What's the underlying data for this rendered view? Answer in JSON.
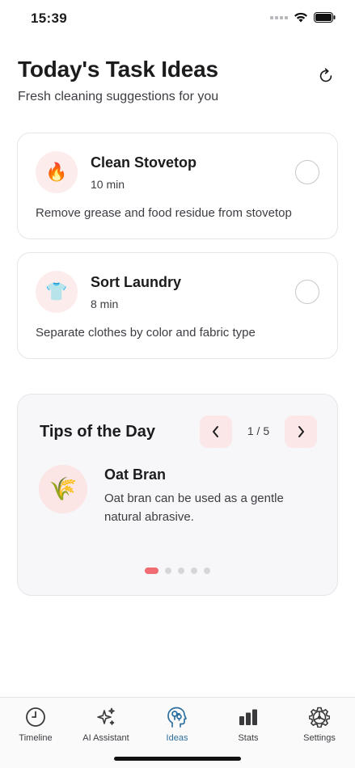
{
  "status_bar": {
    "time": "15:39"
  },
  "header": {
    "title": "Today's Task Ideas",
    "subtitle": "Fresh cleaning suggestions for you"
  },
  "tasks": [
    {
      "icon": "🔥",
      "icon_name": "fire-icon",
      "title": "Clean Stovetop",
      "duration": "10 min",
      "description": "Remove grease and food residue from stovetop"
    },
    {
      "icon": "👕",
      "icon_name": "shirt-icon",
      "title": "Sort Laundry",
      "duration": "8 min",
      "description": "Separate clothes by color and fabric type"
    }
  ],
  "tips": {
    "title": "Tips of the Day",
    "counter": "1 / 5",
    "current_index": 1,
    "total": 5,
    "item": {
      "icon": "🌾",
      "icon_name": "rice-sheaf-icon",
      "name": "Oat Bran",
      "text": "Oat bran can be used as a gentle natural abrasive."
    }
  },
  "tab_bar": {
    "active": "Ideas",
    "items": [
      {
        "label": "Timeline",
        "icon_name": "clock-icon"
      },
      {
        "label": "AI Assistant",
        "icon_name": "sparkles-icon"
      },
      {
        "label": "Ideas",
        "icon_name": "brain-head-icon"
      },
      {
        "label": "Stats",
        "icon_name": "bar-chart-icon"
      },
      {
        "label": "Settings",
        "icon_name": "gear-icon"
      }
    ]
  },
  "colors": {
    "accent_active_tab": "#2d6f9e",
    "pagination_active": "#f06b72",
    "icon_circle_bg": "#fdecec"
  }
}
